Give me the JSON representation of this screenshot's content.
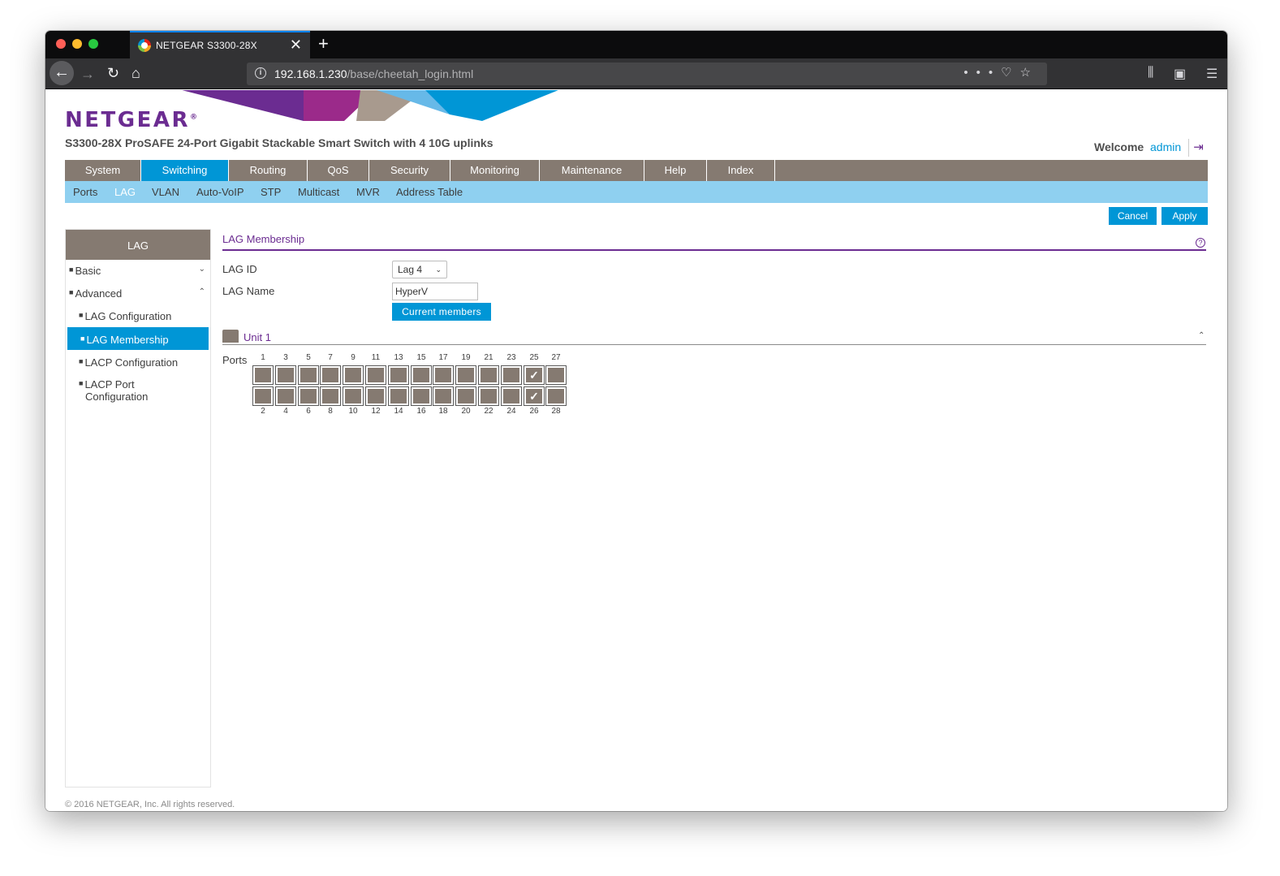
{
  "browser": {
    "tab_title": "NETGEAR S3300-28X",
    "url_host": "192.168.1.230",
    "url_path": "/base/cheetah_login.html"
  },
  "header": {
    "logo": "NETGEAR",
    "logo_mark": "®",
    "product": "S3300-28X ProSAFE 24-Port Gigabit Stackable Smart Switch with 4 10G uplinks",
    "welcome": "Welcome",
    "user": "admin"
  },
  "main_nav": [
    "System",
    "Switching",
    "Routing",
    "QoS",
    "Security",
    "Monitoring",
    "Maintenance",
    "Help",
    "Index"
  ],
  "main_nav_active": "Switching",
  "sub_nav": [
    "Ports",
    "LAG",
    "VLAN",
    "Auto-VoIP",
    "STP",
    "Multicast",
    "MVR",
    "Address Table"
  ],
  "sub_nav_active": "LAG",
  "actions": {
    "cancel": "Cancel",
    "apply": "Apply"
  },
  "sidebar": {
    "title": "LAG",
    "items": [
      {
        "label": "Basic"
      },
      {
        "label": "Advanced"
      },
      {
        "label": "LAG Configuration"
      },
      {
        "label": "LAG Membership"
      },
      {
        "label": "LACP Configuration"
      },
      {
        "label": "LACP Port"
      },
      {
        "label": "Configuration"
      }
    ]
  },
  "content": {
    "title": "LAG Membership",
    "lag_id_label": "LAG ID",
    "lag_id_value": "Lag 4",
    "lag_name_label": "LAG Name",
    "lag_name_value": "HyperV",
    "current_members_button": "Current members",
    "unit_label": "Unit 1",
    "ports_label": "Ports"
  },
  "ports": {
    "top_row": [
      "1",
      "3",
      "5",
      "7",
      "9",
      "11",
      "13",
      "15",
      "17",
      "19",
      "21",
      "23",
      "25",
      "27"
    ],
    "bottom_row": [
      "2",
      "4",
      "6",
      "8",
      "10",
      "12",
      "14",
      "16",
      "18",
      "20",
      "22",
      "24",
      "26",
      "28"
    ],
    "selected": [
      "25",
      "26"
    ]
  },
  "footer": "© 2016 NETGEAR, Inc. All rights reserved.",
  "colors": {
    "brand_purple": "#6b2c91",
    "accent_blue": "#0096d6",
    "nav_gray": "#857a71",
    "subnav_blue": "#8fd0f0"
  }
}
